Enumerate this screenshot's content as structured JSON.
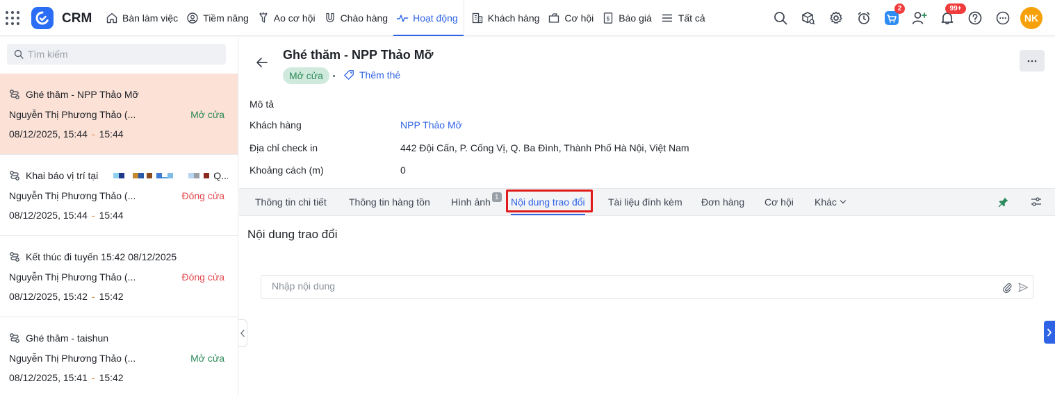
{
  "app": {
    "brand": "CRM"
  },
  "nav": [
    {
      "label": "Bàn làm việc",
      "icon": "home-icon"
    },
    {
      "label": "Tiềm năng",
      "icon": "user-circle-icon"
    },
    {
      "label": "Ao cơ hội",
      "icon": "funnel-icon"
    },
    {
      "label": "Chào hàng",
      "icon": "magnet-icon"
    },
    {
      "label": "Hoạt động",
      "icon": "activity-icon",
      "active": true
    },
    {
      "label": "Khách hàng",
      "icon": "building-icon"
    },
    {
      "label": "Cơ hội",
      "icon": "briefcase-icon"
    },
    {
      "label": "Báo giá",
      "icon": "document-dollar-icon"
    },
    {
      "label": "Tất cả",
      "icon": "menu-icon"
    }
  ],
  "topbar": {
    "cart_badge": "2",
    "notification_badge": "99+",
    "avatar_initials": "NK"
  },
  "sidebar": {
    "search_placeholder": "Tìm kiếm",
    "items": [
      {
        "title": "Ghé thăm - NPP Thảo Mỡ",
        "user": "Nguyễn Thị Phương Thảo (...",
        "status": "Mở cửa",
        "time_start": "08/12/2025, 15:44",
        "time_end": "15:44"
      },
      {
        "title": "Khai báo vị trí tại",
        "title_suffix": "Q....",
        "user": "Nguyễn Thị Phương Thảo (...",
        "status": "Đóng cửa",
        "time_start": "08/12/2025, 15:44",
        "time_end": "15:44"
      },
      {
        "title": "Kết thúc đi tuyến 15:42 08/12/2025",
        "user": "Nguyễn Thị Phương Thảo (...",
        "status": "Đóng cửa",
        "time_start": "08/12/2025, 15:42",
        "time_end": "15:42"
      },
      {
        "title": "Ghé thăm - taishun",
        "user": "Nguyễn Thị Phương Thảo (...",
        "status": "Mở cửa",
        "time_start": "08/12/2025, 15:41",
        "time_end": "15:42"
      }
    ]
  },
  "detail": {
    "title": "Ghé thăm - NPP Thảo Mỡ",
    "status": "Mở cửa",
    "add_tag": "Thêm thẻ",
    "fields": [
      {
        "label": "Mô tả",
        "value": ""
      },
      {
        "label": "Khách hàng",
        "value": "NPP Thảo Mỡ"
      },
      {
        "label": "Địa chỉ check in",
        "value": "442 Đội Cấn, P. Cống Vị, Q. Ba Đình, Thành Phố Hà Nội, Việt Nam"
      },
      {
        "label": "Khoảng cách (m)",
        "value": "0"
      }
    ],
    "tabs": [
      {
        "label": "Thông tin chi tiết"
      },
      {
        "label": "Thông tin hàng tồn"
      },
      {
        "label": "Hình ảnh",
        "count": "1"
      },
      {
        "label": "Nội dung trao đổi",
        "active": true
      },
      {
        "label": "Tài liệu đính kèm"
      },
      {
        "label": "Đơn hàng"
      },
      {
        "label": "Cơ hội"
      },
      {
        "label": "Khác"
      }
    ],
    "section_title": "Nội dung trao đổi",
    "composer_placeholder": "Nhập nội dung"
  },
  "colors": {
    "accent": "#2e63e6",
    "open_status": "#2e8a5a",
    "closed_status": "#e5484d",
    "selected_row": "#fbe1d6",
    "highlight_box": "#e01b1b",
    "avatar": "#f7a10a"
  }
}
